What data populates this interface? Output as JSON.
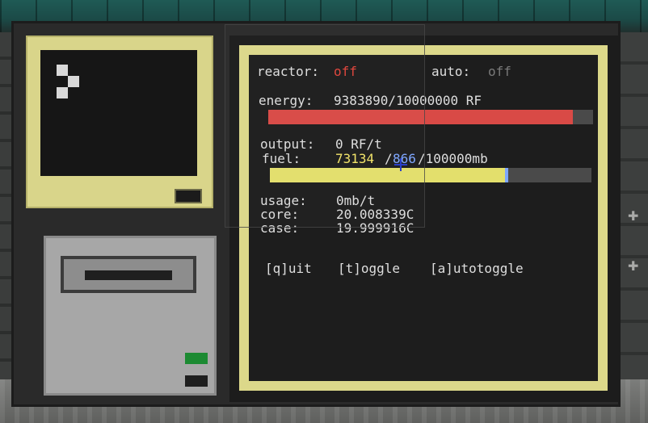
{
  "reactor": {
    "label": "reactor:",
    "status": "off",
    "status_color": "#e0443b"
  },
  "auto": {
    "label": "auto:",
    "status": "off"
  },
  "energy": {
    "label": "energy:",
    "value": "9383890/10000000 RF",
    "fill_fraction": 0.938389,
    "bar_color": "#d94a46"
  },
  "output": {
    "label": "output:",
    "value": "0 RF/t"
  },
  "fuel": {
    "label": "fuel:",
    "amount": "73134",
    "sep1": "/",
    "waste": "866",
    "sep2": "/100000mb",
    "fill_fraction": 0.73134,
    "waste_fraction": 0.00866,
    "bar_color": "#e3df6c",
    "waste_color": "#7da6ff"
  },
  "stats": {
    "usage_label": "usage:",
    "usage_value": "0mb/t",
    "core_label": "core:",
    "core_value": "20.008339C",
    "case_label": "case:",
    "case_value": "19.999916C"
  },
  "controls": {
    "quit": "[q]uit",
    "toggle": "[t]oggle",
    "autotoggle": "[a]utotoggle"
  }
}
